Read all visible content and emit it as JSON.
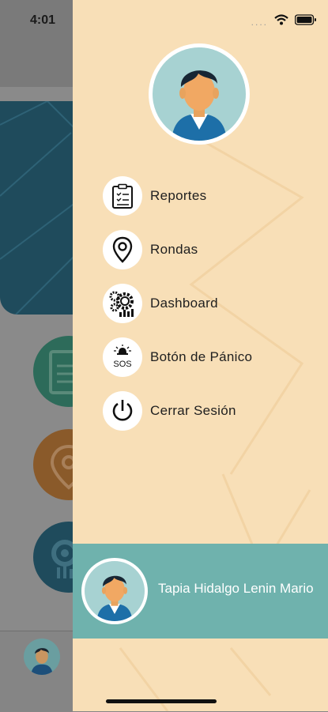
{
  "status_bar": {
    "time": "4:01",
    "signal_dots": "....",
    "icons": [
      "wifi-icon",
      "battery-icon"
    ]
  },
  "drawer": {
    "avatar_icon": "user-avatar",
    "menu": [
      {
        "label": "Reportes",
        "icon": "clipboard-icon"
      },
      {
        "label": "Rondas",
        "icon": "location-pin-icon"
      },
      {
        "label": "Dashboard",
        "icon": "gears-chart-icon"
      },
      {
        "label": "Botón de Pánico",
        "icon": "sos-alarm-icon"
      },
      {
        "label": "Cerrar Sesión",
        "icon": "power-icon"
      }
    ],
    "user": {
      "name": "Tapia Hidalgo Lenin Mario"
    }
  },
  "colors": {
    "drawer_bg": "#f8dfb7",
    "footer_bg": "#6fb2ad",
    "avatar_bg": "#a7d2d2",
    "overlay": "#8a8a8a"
  }
}
